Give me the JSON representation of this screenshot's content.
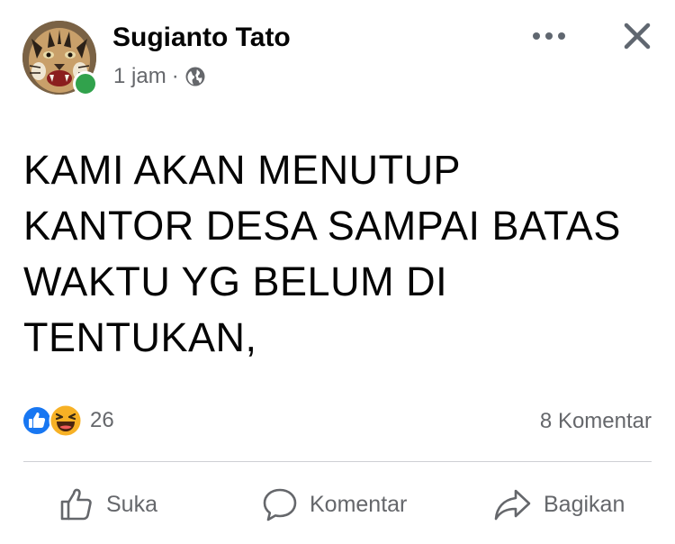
{
  "post": {
    "author": "Sugianto Tato",
    "time": "1 jam",
    "separator": "·",
    "privacy_icon": "globe-icon",
    "text": "KAMI AKAN MENUTUP\nKANTOR DESA SAMPAI BATAS\nWAKTU YG BELUM DI\nTENTUKAN,",
    "reaction_icons": [
      "like-reaction-icon",
      "haha-reaction-icon"
    ],
    "reaction_count": "26",
    "comment_count": "8 Komentar"
  },
  "actions": {
    "like": "Suka",
    "comment": "Komentar",
    "share": "Bagikan"
  },
  "colors": {
    "text_primary": "#050505",
    "text_secondary": "#65676b",
    "online": "#31a24c",
    "like_blue": "#1877f2",
    "haha_yellow": "#f7b125",
    "divider": "#ced0d4"
  }
}
